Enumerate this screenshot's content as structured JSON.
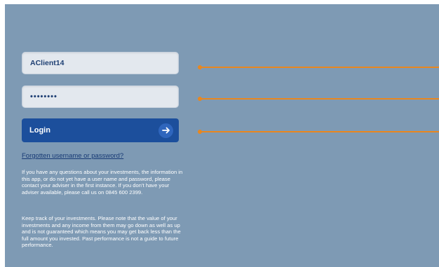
{
  "login_form": {
    "username_value": "AClient14",
    "password_value": "••••••••",
    "login_label": "Login",
    "forgot_link": "Forgotten username or password?"
  },
  "info": {
    "paragraph1": "If you have any questions about your investments, the information in this app, or do not yet have a user name and password, please contact your adviser in the first instance. If you don’t have your adviser available, please call us on 0845 600 2399.",
    "paragraph2": "Keep track of your investments. Please note that the value of your investments and any income from them may go down as well as up and is not guaranteed which means you may get back less than the full amount you invested.  Past performance is not a guide to future performance."
  },
  "icons": {
    "login_arrow": "arrow-right-icon"
  },
  "colors": {
    "background": "#7e9ab4",
    "button": "#1c4f9c",
    "field": "#e3e8ee",
    "callout": "#e8871f",
    "link": "#173a75"
  }
}
